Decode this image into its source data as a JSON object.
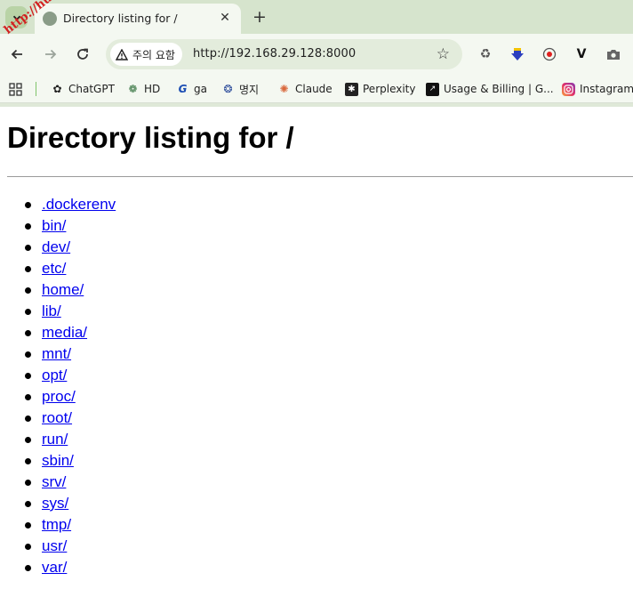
{
  "tab": {
    "title": "Directory listing for /",
    "close": "✕",
    "new_tab": "+"
  },
  "toolbar": {
    "security_label": "주의 요함",
    "url": "http://192.168.29.128:8000"
  },
  "bookmarks": [
    {
      "label": "ChatGPT",
      "icon": "chatgpt-icon"
    },
    {
      "label": "HD",
      "icon": "hd-icon"
    },
    {
      "label": "ga",
      "icon": "ga-icon"
    },
    {
      "label": "명지",
      "icon": "myongji-icon"
    },
    {
      "label": "Claude",
      "icon": "claude-icon"
    },
    {
      "label": "Perplexity",
      "icon": "perplexity-icon"
    },
    {
      "label": "Usage & Billing | G...",
      "icon": "usage-icon"
    },
    {
      "label": "Instagram",
      "icon": "instagram-icon"
    }
  ],
  "watermark": "http://hulb.r",
  "page": {
    "heading": "Directory listing for /",
    "entries": [
      ".dockerenv",
      "bin/",
      "dev/",
      "etc/",
      "home/",
      "lib/",
      "media/",
      "mnt/",
      "opt/",
      "proc/",
      "root/",
      "run/",
      "sbin/",
      "srv/",
      "sys/",
      "tmp/",
      "usr/",
      "var/"
    ]
  },
  "colors": {
    "link": "#0000ee",
    "chrome": "#f4f8f1",
    "tabstrip": "#d6e4cd"
  }
}
